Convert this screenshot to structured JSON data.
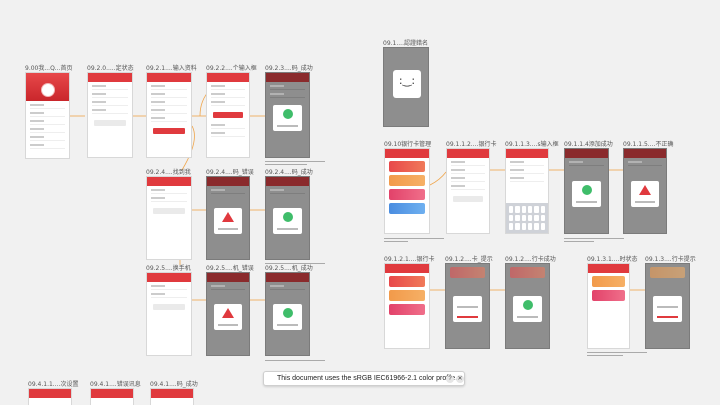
{
  "boards": [
    {
      "title": "9.00我...Q...首页"
    },
    {
      "title": "09.2.0.....定状态"
    },
    {
      "title": "09.2.1....输入资料"
    },
    {
      "title": "09.2.2....个输入框"
    },
    {
      "title": "09.2.3....码_成功"
    },
    {
      "title": "09.2.4....找到我"
    },
    {
      "title": "09.2.4....码_错误"
    },
    {
      "title": "09.2.4....码_成功"
    },
    {
      "title": "09.2.5....换手机"
    },
    {
      "title": "09.2.5....机_错误"
    },
    {
      "title": "09.2.5....机_成功"
    },
    {
      "title": "09.1....認證錯名"
    },
    {
      "title": "09.10银行卡管理"
    },
    {
      "title": "09.1.1.2....银行卡"
    },
    {
      "title": "09.1.1.3....s输入框"
    },
    {
      "title": "09.1.1.4添加成功"
    },
    {
      "title": "09.1.1.5....不正确"
    },
    {
      "title": "09.1.2.1....银行卡"
    },
    {
      "title": "09.1.2....卡_提示"
    },
    {
      "title": "09.1.2....行卡成功"
    },
    {
      "title": "09.1.3.1....时状态"
    },
    {
      "title": "09.1.3....行卡提示"
    },
    {
      "title": "09.4.1.1....次设置"
    },
    {
      "title": "09.4.1....错误讯息"
    },
    {
      "title": "09.4.1....码_成功"
    }
  ],
  "face_glyph": ":‿:",
  "banner": {
    "text": "This document uses the sRGB IEC61966-2.1 color profile.",
    "help": "?",
    "close": "✕"
  },
  "colors": {
    "brand_red": "#e03a3e",
    "success_green": "#3fbd6a",
    "overlay_gray": "#8e8e8e",
    "flow_orange": "#f0a54a",
    "canvas": "#f1f1f1"
  }
}
